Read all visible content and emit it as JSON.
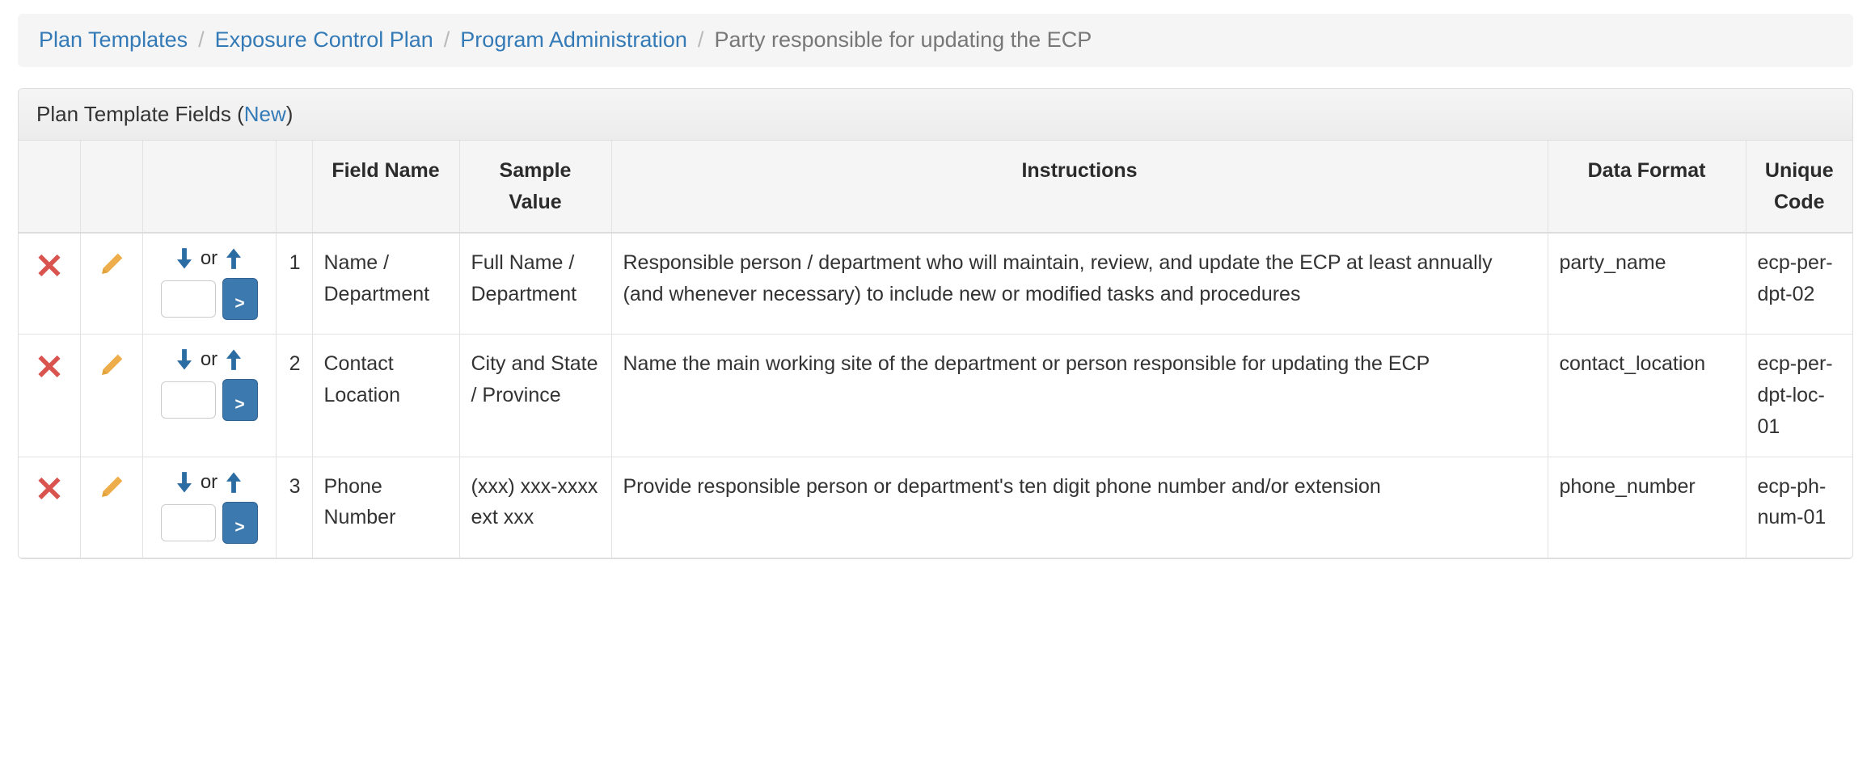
{
  "breadcrumb": {
    "items": [
      {
        "label": "Plan Templates",
        "active": false
      },
      {
        "label": "Exposure Control Plan",
        "active": false
      },
      {
        "label": "Program Administration",
        "active": false
      },
      {
        "label": "Party responsible for updating the ECP",
        "active": true
      }
    ],
    "separator": "/"
  },
  "panel": {
    "title_prefix": "Plan Template Fields (",
    "new_link": "New",
    "title_suffix": ")"
  },
  "table": {
    "headers": {
      "delete": "",
      "edit": "",
      "move": "",
      "number": "",
      "field_name": "Field Name",
      "sample_value": "Sample Value",
      "instructions": "Instructions",
      "data_format": "Data Format",
      "unique_code": "Unique Code"
    },
    "controls": {
      "or_label": "or",
      "go_label": ">",
      "move_input_value": "",
      "delete_icon": "red-x-icon",
      "edit_icon": "orange-pencil-icon",
      "down_icon": "down-arrow-icon",
      "up_icon": "up-arrow-icon"
    },
    "rows": [
      {
        "number": "1",
        "field_name": "Name / Department",
        "sample_value": "Full Name / Department",
        "instructions": "Responsible person / department who will maintain, review, and update the ECP at least annually (and whenever necessary) to include new or modified tasks and procedures",
        "data_format": "party_name",
        "unique_code": "ecp-per-dpt-02"
      },
      {
        "number": "2",
        "field_name": "Contact Location",
        "sample_value": "City and State / Province",
        "instructions": "Name the main working site of the department or person responsible for updating the ECP",
        "data_format": "contact_location",
        "unique_code": "ecp-per-dpt-loc-01"
      },
      {
        "number": "3",
        "field_name": "Phone Number",
        "sample_value": "(xxx) xxx-xxxx ext xxx",
        "instructions": "Provide responsible person or department's ten digit phone number and/or extension",
        "data_format": "phone_number",
        "unique_code": "ecp-ph-num-01"
      }
    ]
  },
  "colors": {
    "link": "#337ab7",
    "delete_icon": "#d9534f",
    "edit_icon": "#eead4b",
    "arrow": "#2b6ca3",
    "button": "#3b79af"
  }
}
